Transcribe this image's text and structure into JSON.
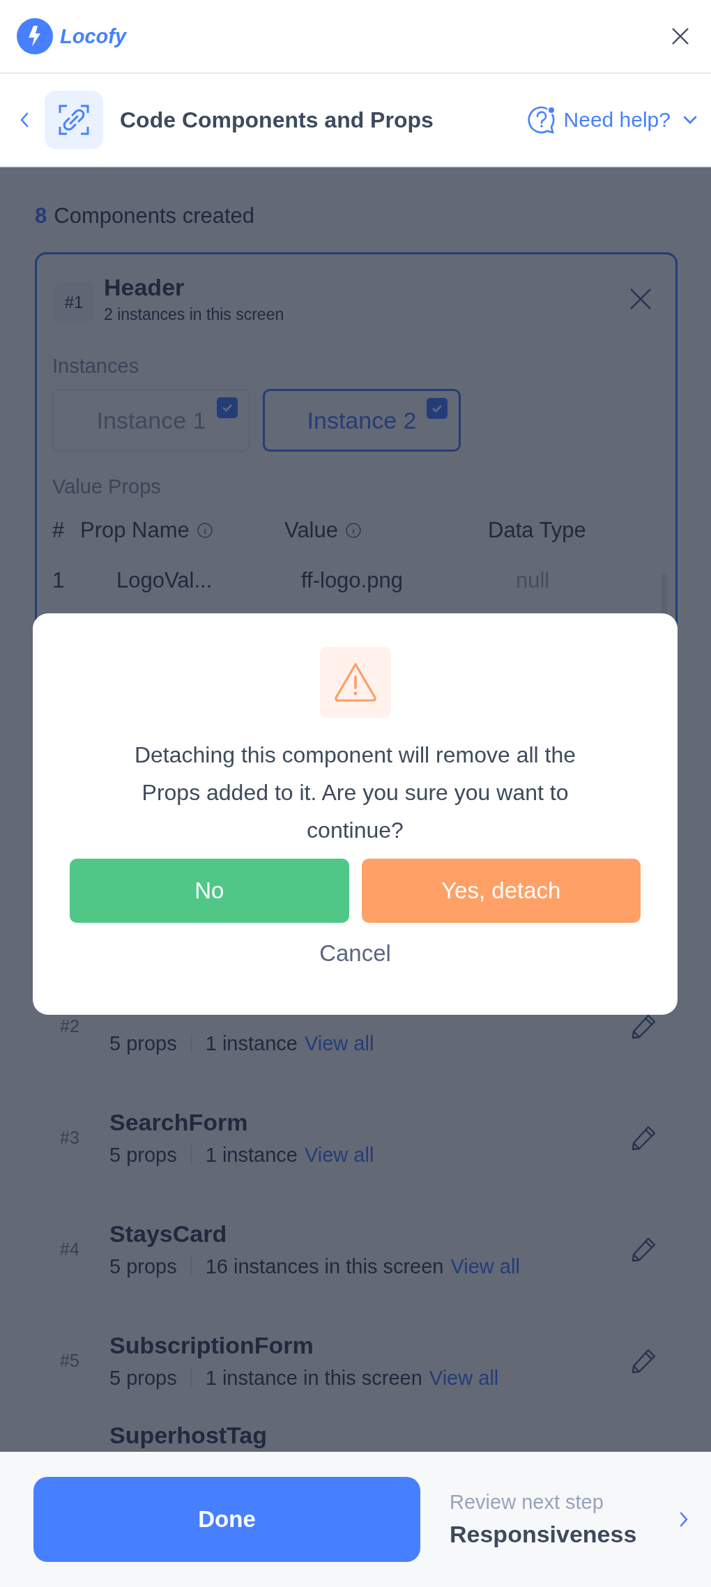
{
  "app_bar": {
    "brand": "Locofy"
  },
  "title_bar": {
    "title": "Code Components and Props",
    "help": "Need help?"
  },
  "summary": {
    "count": "8",
    "label": "Components created"
  },
  "expanded_component": {
    "number": "#1",
    "name": "Header",
    "subtitle": "2 instances in this screen",
    "instances_label": "Instances",
    "instances": [
      {
        "label": "Instance 1",
        "selected": false,
        "checked": true
      },
      {
        "label": "Instance 2",
        "selected": true,
        "checked": true
      }
    ],
    "props_label": "Value Props",
    "table": {
      "columns": [
        {
          "label": "#",
          "info": false
        },
        {
          "label": "Prop Name",
          "info": true
        },
        {
          "label": "Value",
          "info": true
        },
        {
          "label": "Data Type",
          "info": false
        }
      ],
      "rows": [
        [
          "1",
          "LogoVal...",
          "ff-logo.png",
          "null"
        ]
      ]
    }
  },
  "components": [
    {
      "number": "#2",
      "props": "5 props",
      "instances": "1 instance",
      "link": "View all"
    },
    {
      "number": "#3",
      "name": "SearchForm",
      "props": "5 props",
      "instances": "1 instance",
      "link": "View all"
    },
    {
      "number": "#4",
      "name": "StaysCard",
      "props": "5 props",
      "instances": "16 instances in this screen",
      "link": "View all"
    },
    {
      "number": "#5",
      "name": "SubscriptionForm",
      "props": "5 props",
      "instances": "1 instance in this screen",
      "link": "View all"
    },
    {
      "name": "SuperhostTag"
    }
  ],
  "dialog": {
    "message": "Detaching this component will remove all the Props added to it. Are you sure you want to continue?",
    "buttons": [
      {
        "label": "No",
        "kind": "secondary"
      },
      {
        "label": "Yes, detach",
        "kind": "danger"
      }
    ],
    "cancel": "Cancel"
  },
  "footer": {
    "done": "Done",
    "next_caption": "Review next step",
    "next_step": "Responsiveness"
  }
}
